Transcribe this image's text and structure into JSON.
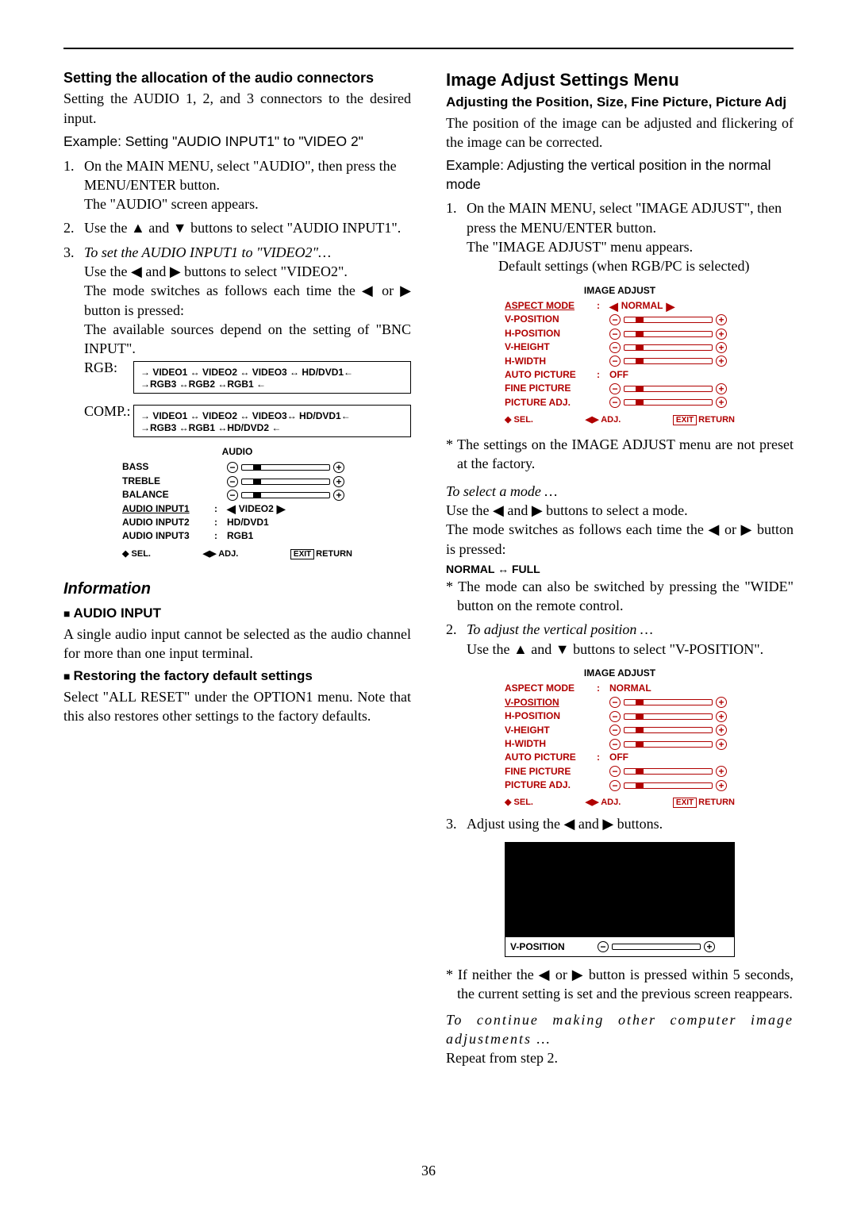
{
  "page_number": "36",
  "left": {
    "h1": "Setting the allocation of the audio connectors",
    "p1": "Setting the AUDIO 1, 2, and 3 connectors to the desired input.",
    "ex": "Example: Setting \"AUDIO INPUT1\" to \"VIDEO 2\"",
    "s1a": "On the MAIN MENU, select \"AUDIO\", then press the MENU/ENTER button.",
    "s1b": "The \"AUDIO\" screen appears.",
    "s2": "Use the ▲ and ▼ buttons to select \"AUDIO INPUT1\".",
    "s3a_it": "To set the AUDIO INPUT1 to \"VIDEO2\"…",
    "s3b": "Use the ◀ and ▶ buttons to select \"VIDEO2\".",
    "s3c": "The mode switches as follows each time the ◀ or ▶ button is pressed:",
    "s3d": "The available sources depend on the setting of \"BNC INPUT\".",
    "rgb": {
      "label": "RGB:",
      "line1": "→ VIDEO1 ↔ VIDEO2 ↔ VIDEO3 ↔ HD/DVD1←",
      "line2": "→RGB3 ↔RGB2 ↔RGB1 ←"
    },
    "comp": {
      "label": "COMP.:",
      "line1": "→ VIDEO1 ↔ VIDEO2 ↔ VIDEO3↔ HD/DVD1←",
      "line2": "→RGB3 ↔RGB1 ↔HD/DVD2 ←"
    },
    "menu": {
      "title": "AUDIO",
      "rows": [
        {
          "label": "BASS",
          "type": "slider"
        },
        {
          "label": "TREBLE",
          "type": "slider"
        },
        {
          "label": "BALANCE",
          "type": "balance"
        },
        {
          "label": "AUDIO INPUT1",
          "type": "sel",
          "value": "VIDEO2"
        },
        {
          "label": "AUDIO INPUT2",
          "type": "txt",
          "value": "HD/DVD1"
        },
        {
          "label": "AUDIO INPUT3",
          "type": "txt",
          "value": "RGB1"
        }
      ],
      "foot_sel": "SEL.",
      "foot_adj": "ADJ.",
      "foot_exit": "EXIT",
      "foot_ret": "RETURN"
    },
    "info_h": "Information",
    "audio_h": "AUDIO INPUT",
    "audio_p": "A single audio input cannot be selected as the audio channel for more than one input terminal.",
    "rest_h": "Restoring the factory default settings",
    "rest_p": "Select \"ALL RESET\" under the OPTION1 menu. Note that this also restores other settings to the factory defaults."
  },
  "right": {
    "h1": "Image Adjust Settings Menu",
    "h2": "Adjusting the Position, Size, Fine Picture, Picture Adj",
    "p1": "The position of the image can be adjusted and flickering of the image can be corrected.",
    "ex": "Example: Adjusting the vertical position in the normal mode",
    "s1a": "On the MAIN MENU, select \"IMAGE ADJUST\", then press the MENU/ENTER button.",
    "s1b": "The \"IMAGE ADJUST\" menu appears.",
    "def": "Default settings (when RGB/PC is selected)",
    "menu1": {
      "title": "IMAGE ADJUST",
      "rows": [
        {
          "label": "ASPECT MODE",
          "type": "sel",
          "value": "NORMAL"
        },
        {
          "label": "V-POSITION",
          "type": "slider"
        },
        {
          "label": "H-POSITION",
          "type": "slider"
        },
        {
          "label": "V-HEIGHT",
          "type": "slider"
        },
        {
          "label": "H-WIDTH",
          "type": "slider"
        },
        {
          "label": "AUTO PICTURE",
          "type": "txt",
          "value": "OFF"
        },
        {
          "label": "FINE PICTURE",
          "type": "slider"
        },
        {
          "label": "PICTURE ADJ.",
          "type": "slider"
        }
      ]
    },
    "note1": "* The settings on the IMAGE ADJUST menu are not preset at the factory.",
    "sel_it": "To select a mode …",
    "sel_p1": "Use the ◀ and ▶ buttons to select a mode.",
    "sel_p2": "The mode switches as follows each time the ◀ or ▶ button is pressed:",
    "sel_nf": "NORMAL ↔ FULL",
    "sel_note": "* The mode can also be switched by pressing the \"WIDE\" button on the remote control.",
    "s2a_it": "To adjust the vertical position …",
    "s2b": "Use the ▲ and ▼ buttons to select \"V-POSITION\".",
    "menu2": {
      "title": "IMAGE ADJUST",
      "rows": [
        {
          "label": "ASPECT MODE",
          "type": "txt",
          "value": "NORMAL"
        },
        {
          "label": "V-POSITION",
          "type": "slider",
          "sel": true
        },
        {
          "label": "H-POSITION",
          "type": "slider"
        },
        {
          "label": "V-HEIGHT",
          "type": "slider"
        },
        {
          "label": "H-WIDTH",
          "type": "slider"
        },
        {
          "label": "AUTO PICTURE",
          "type": "txt",
          "value": "OFF"
        },
        {
          "label": "FINE PICTURE",
          "type": "slider"
        },
        {
          "label": "PICTURE ADJ.",
          "type": "slider"
        }
      ]
    },
    "s3": "Adjust using the ◀ and ▶ buttons.",
    "bb": {
      "label": "V-POSITION"
    },
    "note2": "* If neither the ◀ or ▶ button is pressed within 5 seconds, the current setting is set and the previous screen reappears.",
    "cont_it": "To continue making other computer image adjustments …",
    "cont_p": "Repeat from step 2."
  }
}
